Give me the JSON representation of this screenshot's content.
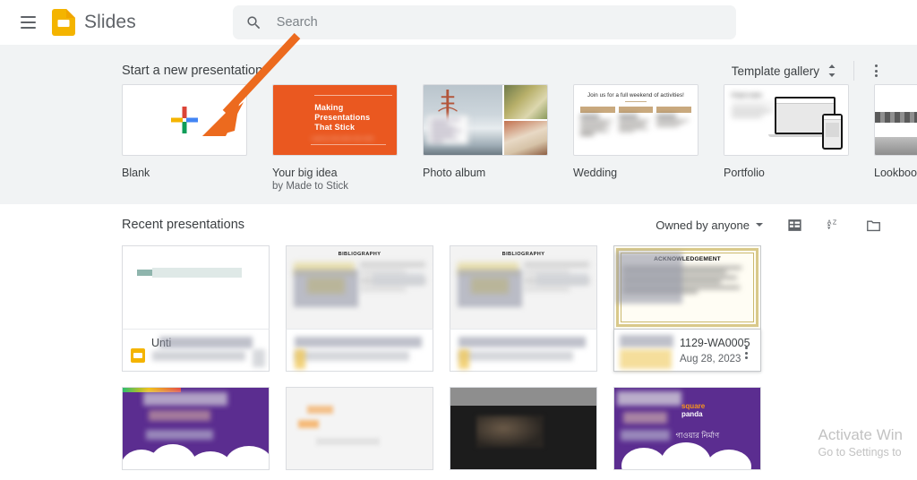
{
  "header": {
    "menu_icon": "hamburger-menu-icon",
    "app_logo_icon": "google-slides-logo-icon",
    "app_name": "Slides",
    "search": {
      "icon": "search-icon",
      "placeholder": "Search",
      "value": ""
    }
  },
  "templates": {
    "section_title": "Start a new presentation",
    "gallery_label": "Template gallery",
    "gallery_toggle_icon": "chevron-up-down-icon",
    "more_icon": "more-vert-icon",
    "items": [
      {
        "label": "Blank",
        "sublabel": "",
        "thumb": "blank-plus-thumb"
      },
      {
        "label": "Your big idea",
        "sublabel": "by Made to Stick",
        "thumb": "big-idea-thumb",
        "thumb_text": "Making Presentations That Stick",
        "thumb_byline": "A guide by Chip Heath & Dan Heath"
      },
      {
        "label": "Photo album",
        "sublabel": "",
        "thumb": "photo-album-thumb"
      },
      {
        "label": "Wedding",
        "sublabel": "",
        "thumb": "wedding-thumb",
        "thumb_text": "Join us for a full weekend of activities!"
      },
      {
        "label": "Portfolio",
        "sublabel": "",
        "thumb": "portfolio-thumb",
        "thumb_text": "Project name"
      },
      {
        "label": "Lookbook",
        "sublabel": "",
        "thumb": "lookbook-thumb"
      }
    ]
  },
  "recent": {
    "section_title": "Recent presentations",
    "owner_filter": "Owned by anyone",
    "owner_caret_icon": "caret-down-icon",
    "list_view_icon": "list-view-icon",
    "sort_icon": "sort-az-icon",
    "folder_icon": "folder-picker-icon",
    "cards": [
      {
        "title": "Unti",
        "date": "",
        "thumb": "untitled-doc-thumb",
        "redacted": true,
        "selected": false
      },
      {
        "title": "",
        "date": "",
        "thumb": "bibliography-thumb",
        "thumb_heading": "BIBLIOGRAPHY",
        "redacted": true,
        "selected": false
      },
      {
        "title": "",
        "date": "",
        "thumb": "bibliography-thumb",
        "thumb_heading": "BIBLIOGRAPHY",
        "redacted": true,
        "selected": false
      },
      {
        "title": "1129-WA0005",
        "date": "Aug 28, 2023",
        "thumb": "acknowledgement-thumb",
        "thumb_heading": "ACKNOWLEDGEMENT",
        "redacted": true,
        "selected": true
      }
    ],
    "cards_row2": [
      {
        "thumb": "purple-cloud-thumb"
      },
      {
        "thumb": "light-photo-thumb"
      },
      {
        "thumb": "dark-photo-thumb"
      },
      {
        "thumb": "square-panda-thumb",
        "logo_line1": "square",
        "logo_line2": "panda",
        "thumb_text": "গাওয়ার নির্মাণ"
      }
    ]
  },
  "watermark": {
    "line1": "Activate Win",
    "line2": "Go to Settings to"
  },
  "annotation": {
    "type": "arrow",
    "color": "#ec6a1e",
    "points_to": "blank-presentation-card"
  },
  "colors": {
    "accent_orange": "#ea5820",
    "surface_gray": "#f1f3f4",
    "text_primary": "#3c4043",
    "text_secondary": "#5f6368",
    "border": "#dadce0"
  }
}
